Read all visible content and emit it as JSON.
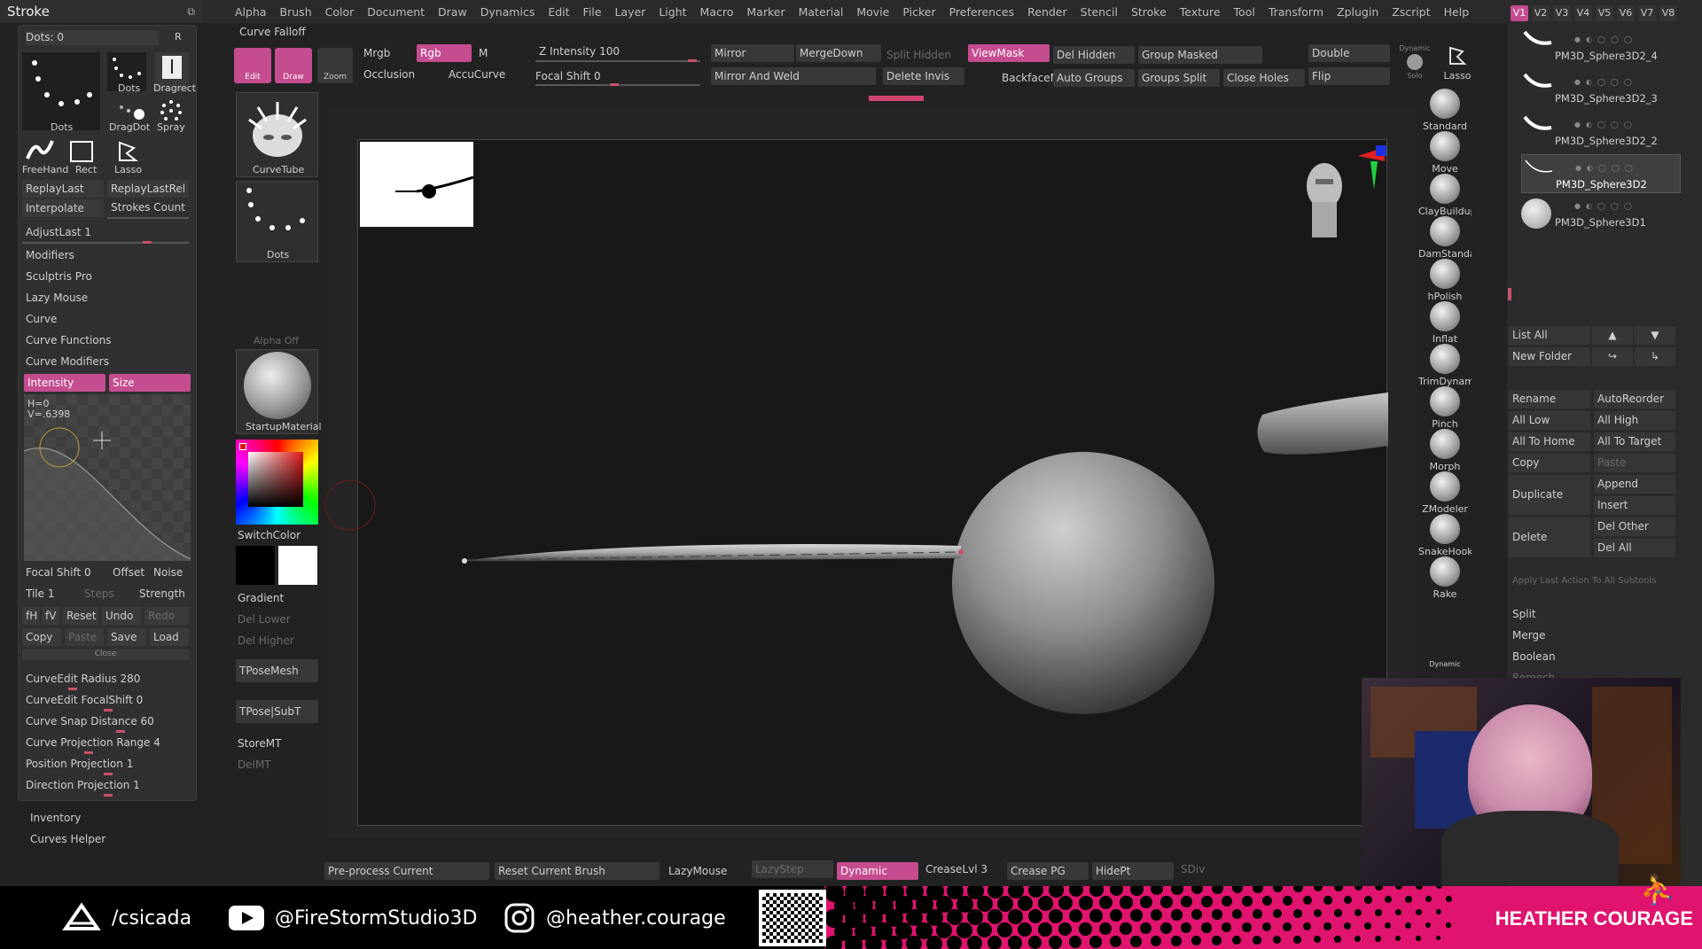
{
  "title_strip": {
    "title": "Stroke"
  },
  "menu": [
    "Alpha",
    "Brush",
    "Color",
    "Document",
    "Draw",
    "Dynamics",
    "Edit",
    "File",
    "Layer",
    "Light",
    "Macro",
    "Marker",
    "Material",
    "Movie",
    "Picker",
    "Preferences",
    "Render",
    "Stencil",
    "Stroke",
    "Texture",
    "Tool",
    "Transform",
    "Zplugin",
    "Zscript",
    "Help"
  ],
  "stroke_panel": {
    "dots_label": "Dots: 0",
    "r_label": "R",
    "stroke_types": [
      "Dots",
      "Dots",
      "Dragrect",
      "DragDot",
      "Spray",
      "FreeHand",
      "Rect",
      "Lasso"
    ],
    "replay_last": "ReplayLast",
    "replay_last_rel": "ReplayLastRel",
    "interpolate": "Interpolate",
    "strokes_count": "Strokes Count",
    "adjust_last": "AdjustLast 1",
    "sections": [
      "Modifiers",
      "Sculptris Pro",
      "Lazy Mouse",
      "Curve",
      "Curve Functions",
      "Curve Modifiers"
    ],
    "intensity": "Intensity",
    "size": "Size",
    "curve_h": "H=0",
    "curve_v": "V=.6398",
    "focal_shift": "Focal Shift 0",
    "offset": "Offset",
    "noise": "Noise",
    "tile": "Tile 1",
    "steps": "Steps",
    "strength": "Strength",
    "fh": "fH",
    "fv": "fV",
    "reset": "Reset",
    "undo": "Undo",
    "redo": "Redo",
    "copy": "Copy",
    "paste": "Paste",
    "save": "Save",
    "load": "Load",
    "close": "Close",
    "curve_edit_radius": "CurveEdit Radius 280",
    "curve_edit_focal": "CurveEdit FocalShift 0",
    "curve_snap": "Curve Snap Distance 60",
    "curve_proj": "Curve Projection Range 4",
    "pos_proj": "Position Projection 1",
    "dir_proj": "Direction Projection 1",
    "inventory": "Inventory",
    "curves_helper": "Curves Helper"
  },
  "col2": {
    "curve_falloff": "Curve Falloff",
    "brush_name": "CurveTube",
    "stroke_name": "Dots",
    "alpha_off": "Alpha Off",
    "material_name": "StartupMaterial",
    "switch_color": "SwitchColor",
    "gradient": "Gradient",
    "del_lower": "Del Lower",
    "del_higher": "Del Higher",
    "tpose_mesh": "TPoseMesh",
    "tpose_subt": "TPose|SubT",
    "store_mt": "StoreMT",
    "del_mt": "DelMT"
  },
  "toolbar": {
    "edit": "Edit",
    "draw": "Draw",
    "zoom": "Zoom",
    "mrgb": "Mrgb",
    "rgb": "Rgb",
    "m": "M",
    "occlusion": "Occlusion",
    "accucurve": "AccuCurve",
    "z_intensity": "Z Intensity 100",
    "focal_shift": "Focal Shift 0",
    "mirror": "Mirror",
    "merge_down": "MergeDown",
    "split_hidden": "Split Hidden",
    "viewmask": "ViewMask",
    "del_hidden": "Del Hidden",
    "group_masked": "Group Masked",
    "double": "Double",
    "dynamic": "Dynamic",
    "solo": "Solo",
    "mirror_weld": "Mirror And Weld",
    "delete_invis": "Delete Invis",
    "backface": "BackfaceMask",
    "auto_groups": "Auto Groups",
    "groups_split": "Groups Split",
    "close_holes": "Close Holes",
    "flip": "Flip",
    "lasso": "Lasso"
  },
  "right_tools": [
    "Standard",
    "Move",
    "ClayBuildup",
    "DamStandard",
    "hPolish",
    "Inflat",
    "TrimDynamic",
    "Pinch",
    "Morph",
    "ZModeler",
    "SnakeHook",
    "Rake"
  ],
  "right_tool_dynamic": "Dynamic",
  "subtool": {
    "tabs": [
      "V1",
      "V2",
      "V3",
      "V4",
      "V5",
      "V6",
      "V7",
      "V8"
    ],
    "items": [
      "PM3D_Sphere3D2_4",
      "PM3D_Sphere3D2_3",
      "PM3D_Sphere3D2_2",
      "PM3D_Sphere3D2",
      "PM3D_Sphere3D1"
    ],
    "list_all": "List All",
    "new_folder": "New Folder",
    "rename": "Rename",
    "auto_reorder": "AutoReorder",
    "all_low": "All Low",
    "all_high": "All High",
    "all_to_home": "All To Home",
    "all_to_target": "All To Target",
    "copy": "Copy",
    "paste": "Paste",
    "duplicate": "Duplicate",
    "append": "Append",
    "insert": "Insert",
    "delete": "Delete",
    "del_other": "Del Other",
    "del_all": "Del All",
    "apply_last": "Apply Last Action To All Subtools",
    "split": "Split",
    "merge": "Merge",
    "boolean": "Boolean",
    "remesh": "Remesh"
  },
  "bottom_toolbar": {
    "preprocess": "Pre-process Current",
    "reset_brush": "Reset Current Brush",
    "lazymouse": "LazyMouse",
    "lazystep": "LazyStep",
    "dynamic": "Dynamic",
    "crease_lvl": "CreaseLvl 3",
    "crease_pg": "Crease PG",
    "hide_pt": "HidePt",
    "sdiv": "SDiv"
  },
  "footer": {
    "artstation": "/csicada",
    "youtube": "@FireStormStudio3D",
    "instagram": "@heather.courage",
    "name": "HEATHER COURAGE"
  },
  "colors": {
    "accent": "#c54c8f",
    "brand_pink": "#e0136e"
  }
}
